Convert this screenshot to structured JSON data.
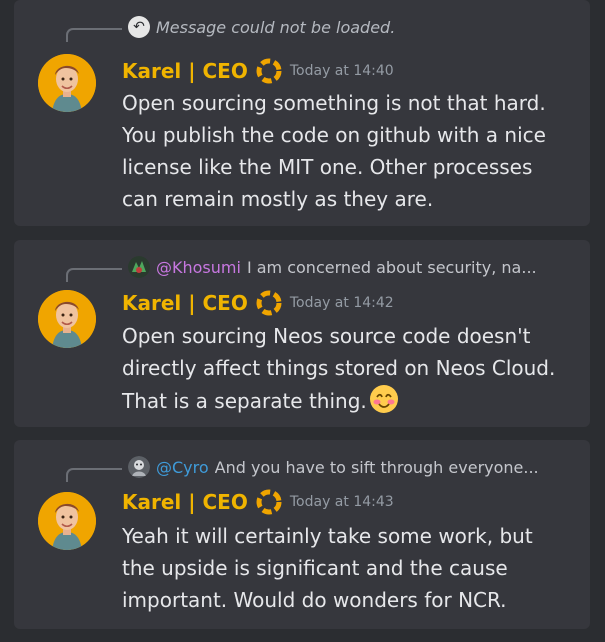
{
  "colors": {
    "background": "#2b2d31",
    "card": "#36373d",
    "author": "#f0b400",
    "khosumi": "#c777e0",
    "cyro": "#3f9bd9",
    "text": "#e6e7ea",
    "muted": "#949ba4"
  },
  "messages": [
    {
      "reply": {
        "icon": "reply-arrow-icon",
        "text": "Message could not be loaded."
      },
      "author": "Karel | CEO",
      "badge": "lifebuoy-icon",
      "timestamp": "Today at 14:40",
      "body": "Open sourcing something is not that hard. You publish the code on github with a nice license like the MIT one. Other processes can remain mostly as they are."
    },
    {
      "reply": {
        "name": "@Khosumi",
        "text": "I am concerned about security, na..."
      },
      "author": "Karel | CEO",
      "badge": "lifebuoy-icon",
      "timestamp": "Today at 14:42",
      "body": "Open sourcing Neos source code doesn't directly affect things stored on Neos Cloud. That is a separate thing.",
      "emoji": "blush-emoji-icon"
    },
    {
      "reply": {
        "name": "@Cyro",
        "text": "And you have to sift through everyone..."
      },
      "author": "Karel | CEO",
      "badge": "lifebuoy-icon",
      "timestamp": "Today at 14:43",
      "body": "Yeah it will certainly take some work, but the upside is significant and the cause important. Would do wonders for NCR."
    }
  ]
}
